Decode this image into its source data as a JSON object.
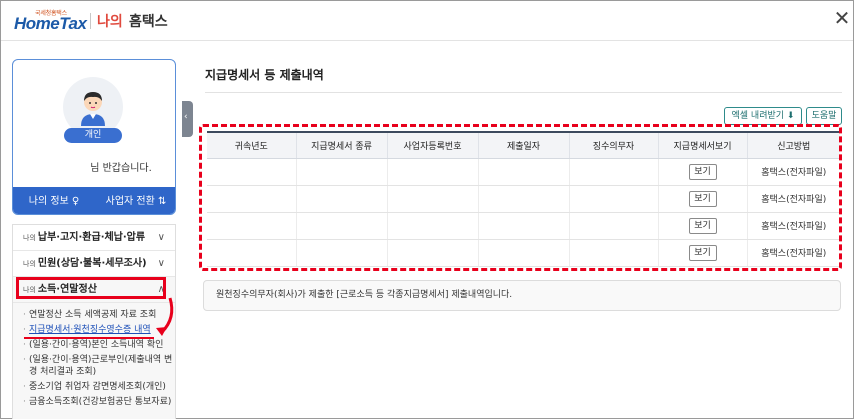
{
  "header": {
    "logo_small": "국세청홈택스",
    "logo_main": "HomeTax",
    "brand_mine": "나의",
    "brand_hometax": "홈택스",
    "close_symbol": "✕"
  },
  "profile": {
    "badge": "개인",
    "greeting": "님 반갑습니다.",
    "my_info": "나의 정보 ♀",
    "switch": "사업자 전환 ⇅"
  },
  "menu": {
    "prefix": "나의",
    "items": [
      {
        "label": "납부·고지·환급·체납·압류",
        "chevron": "∨"
      },
      {
        "label": "민원(상담·불복·세무조사)",
        "chevron": "∨"
      },
      {
        "label": "소득·연말정산",
        "chevron": "∧"
      }
    ],
    "subitems": [
      "연말정산 소득 세액공제 자료 조회",
      "지급명세서·원천징수영수증 내역",
      "(일용·간이·용역)본인 소득내역 확인",
      "(일용·간이·용역)근로부인(제출내역 변경 처리결과 조회)",
      "중소기업 취업자 감면명세조회(개인)",
      "금융소득조회(건강보험공단 통보자료)"
    ]
  },
  "main": {
    "title": "지급명세서 등 제출내역",
    "excel_button": "엑셀 내려받기 ⬇",
    "help_button": "도움말",
    "collapse_symbol": "‹",
    "table": {
      "headers": [
        "귀속년도",
        "지급명세서 종류",
        "사업자등록번호",
        "제출일자",
        "징수의무자",
        "지급명세서보기",
        "신고방법"
      ],
      "rows": [
        {
          "view": "보기",
          "method": "홈택스(전자파일)"
        },
        {
          "view": "보기",
          "method": "홈택스(전자파일)"
        },
        {
          "view": "보기",
          "method": "홈택스(전자파일)"
        },
        {
          "view": "보기",
          "method": "홈택스(전자파일)"
        }
      ]
    },
    "info": "원천징수의무자(회사)가 제출한 [근로소득 등 각종지급명세서] 제출내역입니다."
  },
  "colors": {
    "accent_blue": "#2f66c9",
    "highlight_red": "#e8001c",
    "button_teal": "#2e8b8b"
  }
}
